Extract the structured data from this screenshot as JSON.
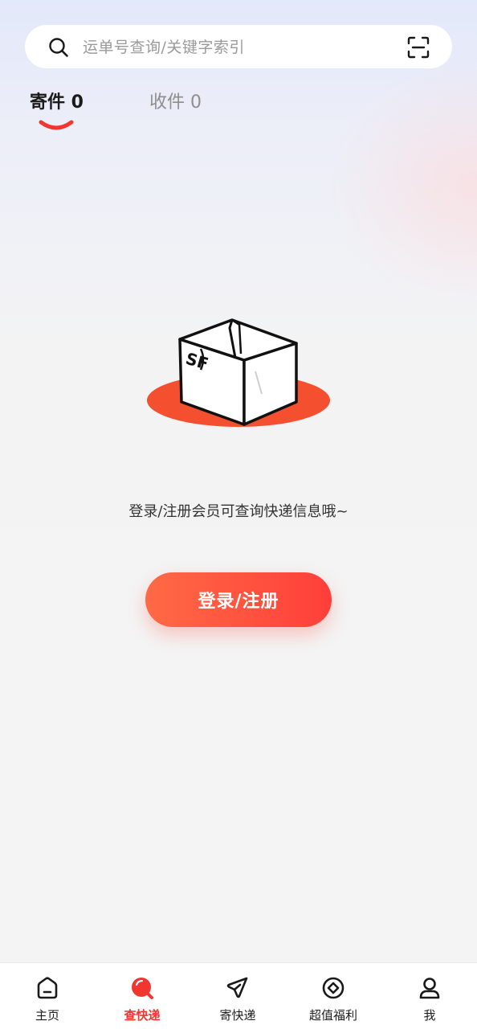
{
  "search": {
    "placeholder": "运单号查询/关键字索引"
  },
  "tabs": {
    "send_label": "寄件 0",
    "receive_label": "收件 0"
  },
  "empty_state": {
    "hint": "登录/注册会员可查询快递信息哦~",
    "box_logo": "SF"
  },
  "login_button": {
    "label": "登录/注册"
  },
  "bottom_nav": {
    "items": [
      {
        "label": "主页",
        "icon": "home-icon"
      },
      {
        "label": "查快递",
        "icon": "query-express-icon",
        "active": true
      },
      {
        "label": "寄快递",
        "icon": "send-express-icon"
      },
      {
        "label": "超值福利",
        "icon": "benefits-icon"
      },
      {
        "label": "我",
        "icon": "profile-icon"
      }
    ]
  },
  "colors": {
    "accent": "#f0362f",
    "button_start": "#ff6a45",
    "button_end": "#ff3f3a"
  }
}
